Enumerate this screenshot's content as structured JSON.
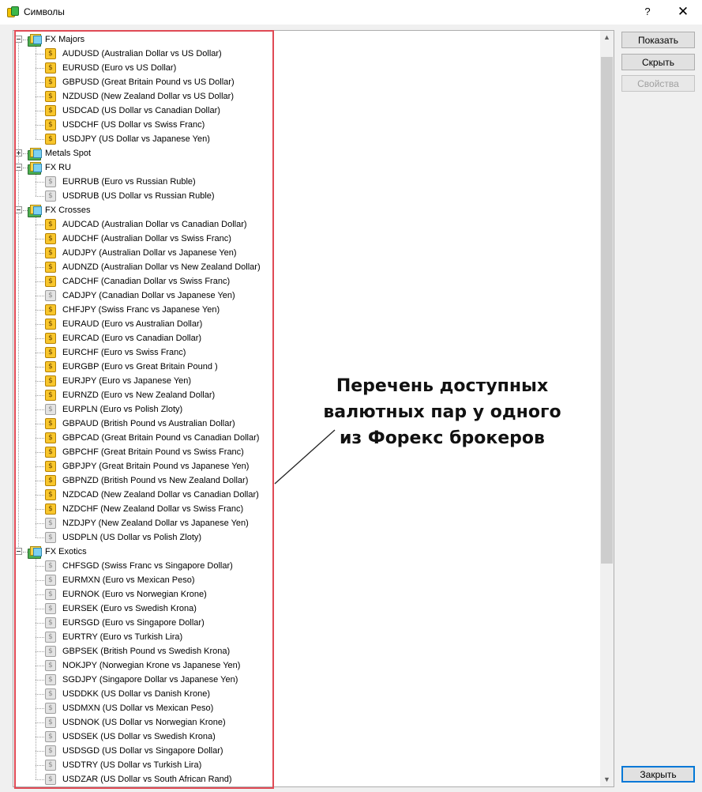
{
  "window": {
    "title": "Символы",
    "help": "?",
    "close": "✕"
  },
  "buttons": {
    "show": "Показать",
    "hide": "Скрыть",
    "properties": "Свойства",
    "close": "Закрыть"
  },
  "annotation": {
    "lines": [
      "Перечень доступных",
      "валютных пар у одного",
      "из Форекс брокеров"
    ]
  },
  "scrollbar": {
    "up": "▲",
    "down": "▼"
  },
  "tree": {
    "groups": [
      {
        "name": "FX Majors",
        "expanded": true,
        "symbols": [
          {
            "text": "AUDUSD  (Australian Dollar vs US Dollar)",
            "active": true
          },
          {
            "text": "EURUSD  (Euro vs US Dollar)",
            "active": true
          },
          {
            "text": "GBPUSD  (Great Britain Pound vs US Dollar)",
            "active": true
          },
          {
            "text": "NZDUSD  (New Zealand Dollar vs US Dollar)",
            "active": true
          },
          {
            "text": "USDCAD  (US Dollar vs Canadian Dollar)",
            "active": true
          },
          {
            "text": "USDCHF  (US Dollar vs Swiss Franc)",
            "active": true
          },
          {
            "text": "USDJPY  (US Dollar vs Japanese Yen)",
            "active": true
          }
        ]
      },
      {
        "name": "Metals Spot",
        "expanded": false,
        "symbols": []
      },
      {
        "name": "FX RU",
        "expanded": true,
        "symbols": [
          {
            "text": "EURRUB  (Euro vs Russian Ruble)",
            "active": false
          },
          {
            "text": "USDRUB  (US Dollar vs Russian Ruble)",
            "active": false
          }
        ]
      },
      {
        "name": "FX Crosses",
        "expanded": true,
        "symbols": [
          {
            "text": "AUDCAD  (Australian Dollar vs Canadian Dollar)",
            "active": true
          },
          {
            "text": "AUDCHF  (Australian Dollar vs Swiss Franc)",
            "active": true
          },
          {
            "text": "AUDJPY  (Australian Dollar vs Japanese Yen)",
            "active": true
          },
          {
            "text": "AUDNZD  (Australian Dollar vs New Zealand Dollar)",
            "active": true
          },
          {
            "text": "CADCHF  (Canadian Dollar vs Swiss Franc)",
            "active": true
          },
          {
            "text": "CADJPY  (Canadian Dollar vs Japanese Yen)",
            "active": false
          },
          {
            "text": "CHFJPY  (Swiss Franc vs Japanese Yen)",
            "active": true
          },
          {
            "text": "EURAUD  (Euro vs Australian Dollar)",
            "active": true
          },
          {
            "text": "EURCAD  (Euro vs Canadian Dollar)",
            "active": true
          },
          {
            "text": "EURCHF  (Euro vs Swiss Franc)",
            "active": true
          },
          {
            "text": "EURGBP  (Euro vs Great Britain Pound )",
            "active": true
          },
          {
            "text": "EURJPY  (Euro vs Japanese Yen)",
            "active": true
          },
          {
            "text": "EURNZD  (Euro vs New Zealand Dollar)",
            "active": true
          },
          {
            "text": "EURPLN  (Euro vs Polish Zloty)",
            "active": false
          },
          {
            "text": "GBPAUD  (British Pound vs Australian Dollar)",
            "active": true
          },
          {
            "text": "GBPCAD  (Great Britain Pound vs Canadian Dollar)",
            "active": true
          },
          {
            "text": "GBPCHF  (Great Britain Pound vs Swiss Franc)",
            "active": true
          },
          {
            "text": "GBPJPY  (Great Britain Pound vs Japanese Yen)",
            "active": true
          },
          {
            "text": "GBPNZD  (British Pound vs New Zealand Dollar)",
            "active": true
          },
          {
            "text": "NZDCAD  (New Zealand Dollar vs Canadian Dollar)",
            "active": true
          },
          {
            "text": "NZDCHF  (New Zealand Dollar vs Swiss Franc)",
            "active": true
          },
          {
            "text": "NZDJPY  (New Zealand Dollar vs Japanese Yen)",
            "active": false
          },
          {
            "text": "USDPLN  (US Dollar vs Polish Zloty)",
            "active": false
          }
        ]
      },
      {
        "name": "FX Exotics",
        "expanded": true,
        "symbols": [
          {
            "text": "CHFSGD  (Swiss Franc vs Singapore Dollar)",
            "active": false
          },
          {
            "text": "EURMXN  (Euro vs Mexican Peso)",
            "active": false
          },
          {
            "text": "EURNOK  (Euro vs Norwegian Krone)",
            "active": false
          },
          {
            "text": "EURSEK  (Euro vs Swedish Krona)",
            "active": false
          },
          {
            "text": "EURSGD  (Euro vs Singapore Dollar)",
            "active": false
          },
          {
            "text": "EURTRY  (Euro vs Turkish Lira)",
            "active": false
          },
          {
            "text": "GBPSEK  (British Pound vs Swedish Krona)",
            "active": false
          },
          {
            "text": "NOKJPY  (Norwegian Krone vs Japanese Yen)",
            "active": false
          },
          {
            "text": "SGDJPY  (Singapore Dollar vs Japanese Yen)",
            "active": false
          },
          {
            "text": "USDDKK  (US Dollar vs Danish Krone)",
            "active": false
          },
          {
            "text": "USDMXN  (US Dollar vs Mexican Peso)",
            "active": false
          },
          {
            "text": "USDNOK  (US Dollar vs Norwegian Krone)",
            "active": false
          },
          {
            "text": "USDSEK  (US Dollar vs Swedish Krona)",
            "active": false
          },
          {
            "text": "USDSGD  (US Dollar vs Singapore Dollar)",
            "active": false
          },
          {
            "text": "USDTRY  (US Dollar vs Turkish Lira)",
            "active": false
          },
          {
            "text": "USDZAR  (US Dollar vs South African Rand)",
            "active": false
          }
        ]
      }
    ]
  }
}
